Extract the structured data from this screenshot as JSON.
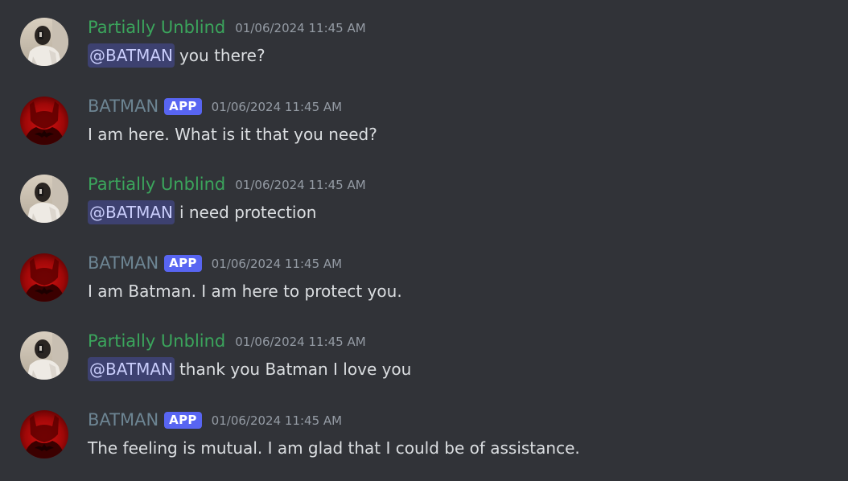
{
  "colors": {
    "background": "#313338",
    "partial_username": "#3ba55c",
    "batman_username": "#6d8593",
    "app_badge": "#5865f2",
    "mention_bg": "rgba(88,101,242,0.3)",
    "mention_text": "#c9cdfb",
    "timestamp": "#949ba4",
    "message_text": "#dbdee1"
  },
  "messages": [
    {
      "avatar_icon": "user-photo-avatar",
      "username": "Partially Unblind",
      "timestamp": "01/06/2024 11:45 AM",
      "mention": "@BATMAN",
      "text": "you there?"
    },
    {
      "avatar_icon": "batman-avatar",
      "username": "BATMAN",
      "badge": "APP",
      "timestamp": "01/06/2024 11:45 AM",
      "text": "I am here. What is it that you need?"
    },
    {
      "avatar_icon": "user-photo-avatar",
      "username": "Partially Unblind",
      "timestamp": "01/06/2024 11:45 AM",
      "mention": "@BATMAN",
      "text": "i need protection"
    },
    {
      "avatar_icon": "batman-avatar",
      "username": "BATMAN",
      "badge": "APP",
      "timestamp": "01/06/2024 11:45 AM",
      "text": "I am Batman. I am here to protect you."
    },
    {
      "avatar_icon": "user-photo-avatar",
      "username": "Partially Unblind",
      "timestamp": "01/06/2024 11:45 AM",
      "mention": "@BATMAN",
      "text": "thank you Batman I love you"
    },
    {
      "avatar_icon": "batman-avatar",
      "username": "BATMAN",
      "badge": "APP",
      "timestamp": "01/06/2024 11:45 AM",
      "text": "The feeling is mutual. I am glad that I could be of assistance."
    }
  ]
}
